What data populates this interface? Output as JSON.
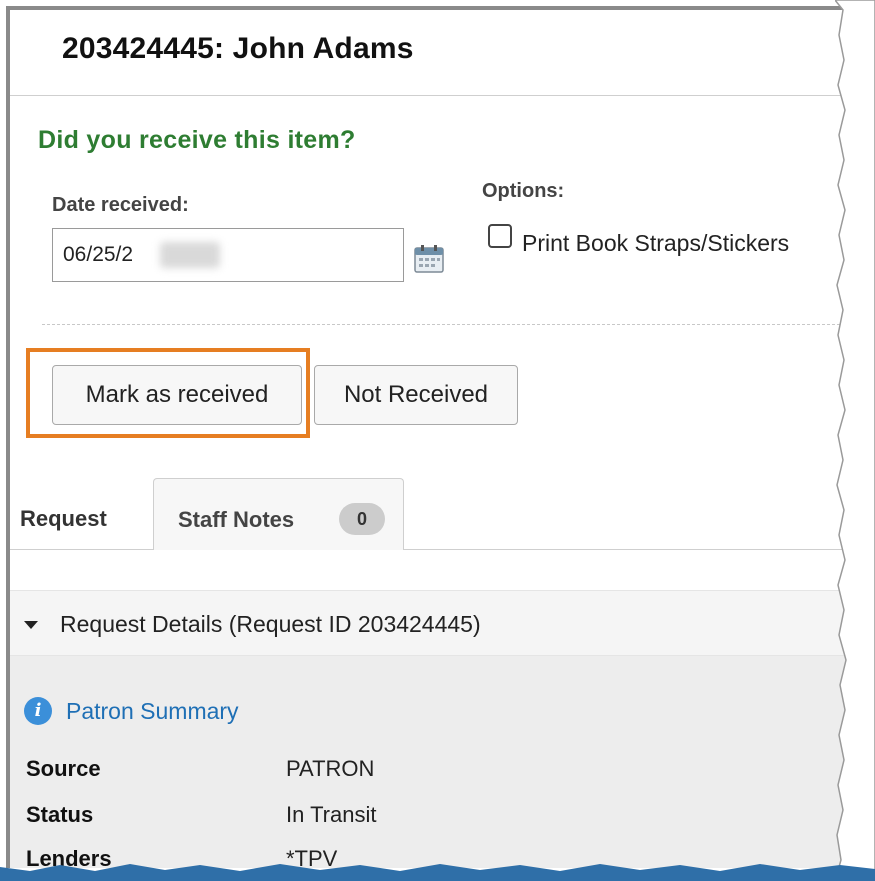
{
  "header": {
    "title": "203424445: John Adams"
  },
  "receive": {
    "question": "Did you receive this item?",
    "date_label": "Date received:",
    "date_value": "06/25/2",
    "options_label": "Options:",
    "print_option_label": "Print Book Straps/Stickers",
    "print_option_checked": false
  },
  "actions": {
    "mark_received": "Mark as received",
    "not_received": "Not Received",
    "highlight_color": "#e67e22"
  },
  "tabs": [
    {
      "label": "Request",
      "active": true
    },
    {
      "label": "Staff Notes",
      "badge": "0",
      "active": false
    }
  ],
  "details": {
    "heading": "Request Details (Request ID 203424445)"
  },
  "patron": {
    "summary_link": "Patron Summary",
    "rows": [
      {
        "label": "Source",
        "value": "PATRON"
      },
      {
        "label": "Status",
        "value": "In Transit"
      },
      {
        "label": "Lenders",
        "value": "*TPV"
      }
    ]
  },
  "colors": {
    "question": "#2e7d32",
    "link": "#1e6fb5",
    "info": "#3b8fd9"
  }
}
